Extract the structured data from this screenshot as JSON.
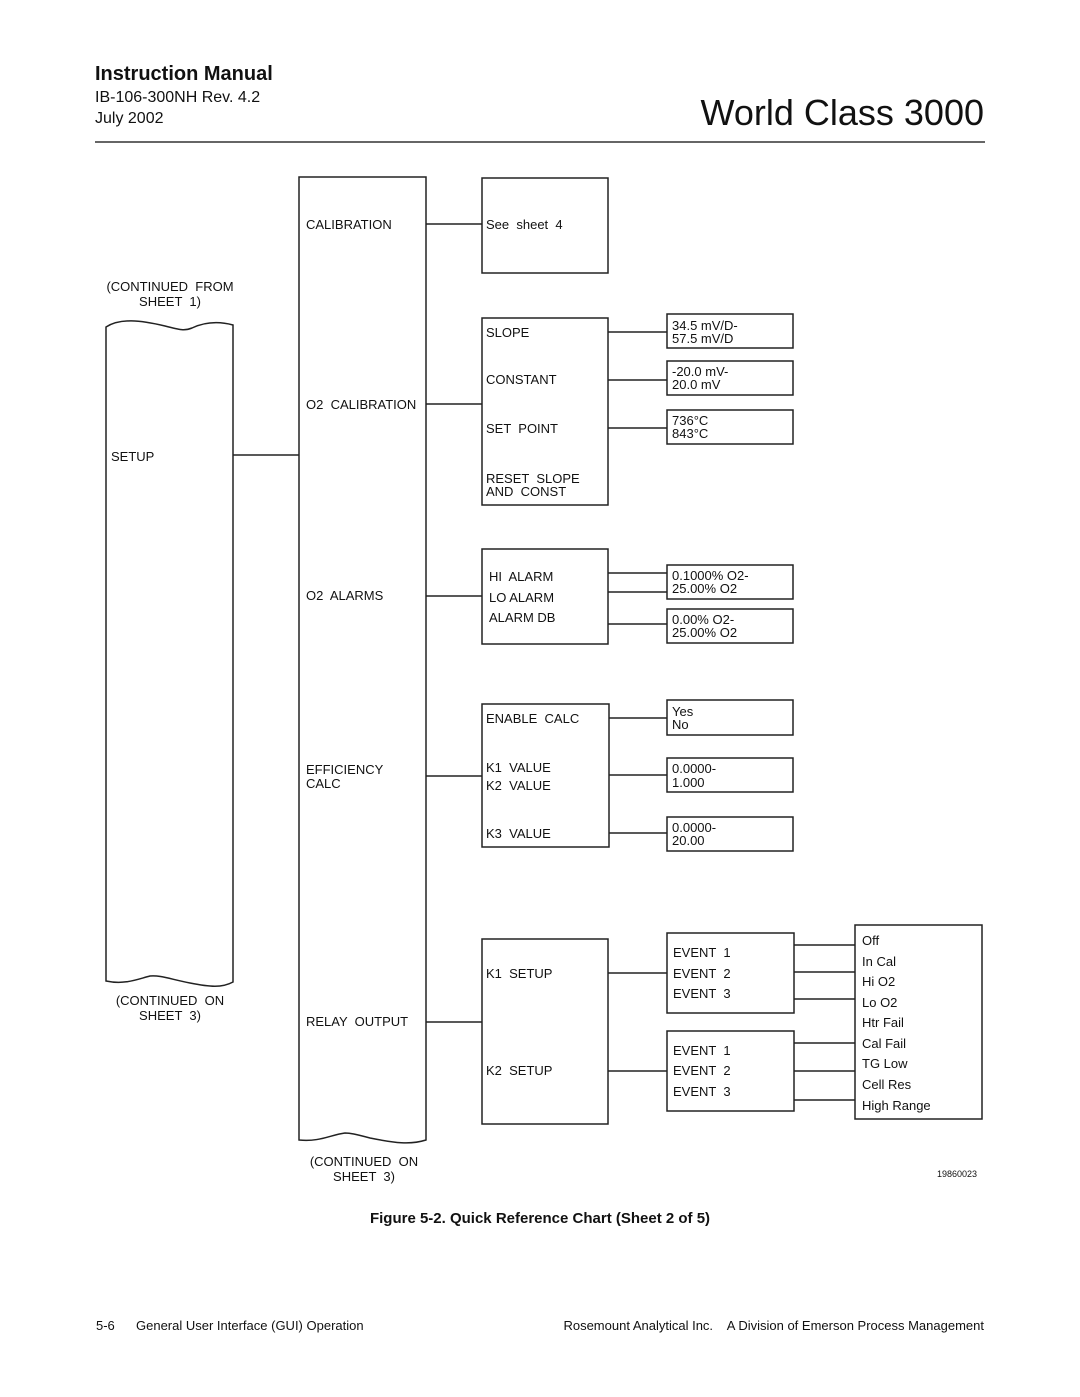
{
  "header": {
    "manual_title": "Instruction Manual",
    "doc_number": "IB-106-300NH Rev. 4.2",
    "date": "July 2002",
    "product": "World Class 3000"
  },
  "diagram": {
    "left_column": {
      "continued_from": [
        "(CONTINUED  FROM",
        "SHEET  1)"
      ],
      "label": "SETUP",
      "continued_on": [
        "(CONTINUED  ON",
        "SHEET  3)"
      ]
    },
    "setup_column": {
      "items": [
        "CALIBRATION",
        "O2  CALIBRATION",
        "O2  ALARMS",
        "EFFICIENCY",
        "CALC",
        "RELAY  OUTPUT"
      ],
      "continued_on": [
        "(CONTINUED  ON",
        "SHEET  3)"
      ]
    },
    "calibration": {
      "text": "See  sheet  4"
    },
    "o2_calibration": {
      "items": [
        "SLOPE",
        "CONSTANT",
        "SET  POINT",
        "RESET  SLOPE",
        "AND  CONST"
      ],
      "ranges": [
        [
          "34.5 mV/D-",
          "57.5 mV/D"
        ],
        [
          "-20.0 mV-",
          "20.0 mV"
        ],
        [
          "736°C",
          "843°C"
        ]
      ]
    },
    "o2_alarms": {
      "items": [
        "HI  ALARM",
        "LO ALARM",
        "ALARM DB"
      ],
      "ranges": [
        [
          "0.1000% O2-",
          "25.00% O2"
        ],
        [
          "0.00% O2-",
          "25.00% O2"
        ]
      ]
    },
    "efficiency_calc": {
      "items": [
        "ENABLE  CALC",
        "K1  VALUE",
        "K2  VALUE",
        "K3  VALUE"
      ],
      "ranges": [
        [
          "Yes",
          "No"
        ],
        [
          "0.0000-",
          "1.000"
        ],
        [
          "0.0000-",
          "20.00"
        ]
      ]
    },
    "relay_output": {
      "items": [
        "K1  SETUP",
        "K2  SETUP"
      ],
      "events": [
        "EVENT  1",
        "EVENT  2",
        "EVENT  3"
      ],
      "options": [
        "Off",
        "In Cal",
        "Hi O2",
        "Lo O2",
        "Htr Fail",
        "Cal Fail",
        "TG Low",
        "Cell Res",
        "High Range"
      ]
    },
    "figure_id": "19860023"
  },
  "caption": "Figure 5-2.  Quick Reference Chart (Sheet 2 of 5)",
  "footer": {
    "page": "5-6",
    "section": "General User Interface (GUI) Operation",
    "company": "Rosemount Analytical Inc.    A Division of Emerson Process Management"
  }
}
